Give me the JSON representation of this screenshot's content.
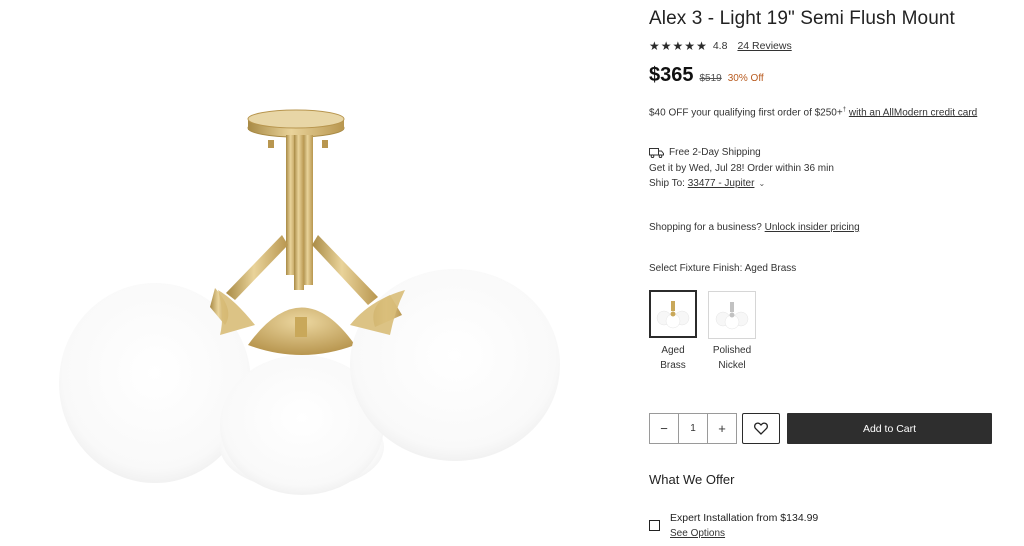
{
  "product": {
    "title": "Alex 3 - Light 19\" Semi Flush Mount",
    "rating": "4.8",
    "stars": 5,
    "reviews_label": "24 Reviews",
    "price": "$365",
    "old_price": "$519",
    "discount": "30% Off"
  },
  "offer": {
    "text": "$40 OFF your qualifying first order of $250+",
    "sup": "†",
    "link": "with an AllModern credit card"
  },
  "shipping": {
    "icon": "truck-icon",
    "title": "Free 2-Day Shipping",
    "eta": "Get it by Wed, Jul 28! Order within 36 min",
    "ship_to_label": "Ship To:",
    "zip_link": "33477 - Jupiter",
    "chevron": "⌄"
  },
  "business": {
    "text": "Shopping for a business?",
    "link": "Unlock insider pricing"
  },
  "finish": {
    "label": "Select Fixture Finish",
    "selected": ": Aged Brass",
    "options": [
      {
        "label_line1": "Aged",
        "label_line2": "Brass",
        "selected": true
      },
      {
        "label_line1": "Polished",
        "label_line2": "Nickel",
        "selected": false
      }
    ]
  },
  "purchase": {
    "minus": "−",
    "quantity": "1",
    "plus": "+",
    "favorite_icon": "heart-icon",
    "add_to_cart": "Add to Cart"
  },
  "what_we_offer": {
    "title": "What We Offer",
    "install_label": "Expert Installation from $134.99",
    "see_options": "See Options"
  },
  "colors": {
    "brass": "#c9a85a",
    "nickel": "#c2c2c2",
    "globe": "#ffffff",
    "accent_discount": "#b85a1e",
    "button_dark": "#2e2e2e"
  }
}
